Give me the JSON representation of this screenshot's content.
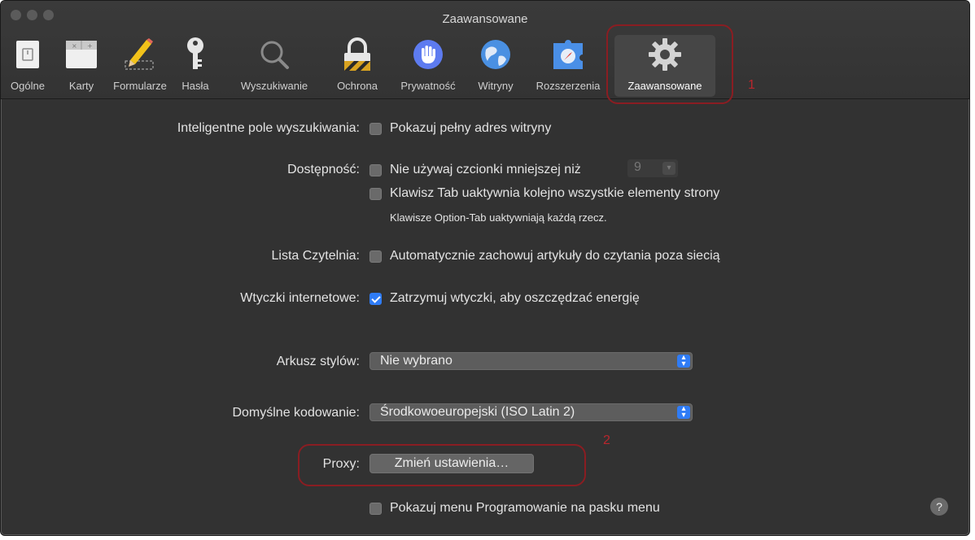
{
  "window": {
    "title": "Zaawansowane"
  },
  "toolbar": {
    "tabs": [
      {
        "label": "Ogólne",
        "icon": "switch-icon"
      },
      {
        "label": "Karty",
        "icon": "tabs-icon"
      },
      {
        "label": "Formularze",
        "icon": "pencil-icon"
      },
      {
        "label": "Hasła",
        "icon": "key-icon"
      },
      {
        "label": "Wyszukiwanie",
        "icon": "magnifier-icon"
      },
      {
        "label": "Ochrona",
        "icon": "lock-icon"
      },
      {
        "label": "Prywatność",
        "icon": "hand-icon"
      },
      {
        "label": "Witryny",
        "icon": "globe-icon"
      },
      {
        "label": "Rozszerzenia",
        "icon": "puzzle-icon"
      },
      {
        "label": "Zaawansowane",
        "icon": "gear-icon"
      }
    ],
    "selected": "Zaawansowane"
  },
  "annotations": {
    "n1": "1",
    "n2": "2"
  },
  "settings": {
    "smart_search": {
      "label": "Inteligentne pole wyszukiwania:",
      "option": "Pokazuj pełny adres witryny",
      "checked": false
    },
    "accessibility": {
      "label": "Dostępność:",
      "min_font_option": "Nie używaj czcionki mniejszej niż",
      "min_font_value": "9",
      "min_font_checked": false,
      "tab_option": "Klawisz Tab uaktywnia kolejno wszystkie elementy strony",
      "tab_checked": false,
      "tab_note": "Klawisze Option-Tab uaktywniają każdą rzecz."
    },
    "reading_list": {
      "label": "Lista Czytelnia:",
      "option": "Automatycznie zachowuj artykuły do czytania poza siecią",
      "checked": false
    },
    "plugins": {
      "label": "Wtyczki internetowe:",
      "option": "Zatrzymuj wtyczki, aby oszczędzać energię",
      "checked": true
    },
    "stylesheet": {
      "label": "Arkusz stylów:",
      "value": "Nie wybrano"
    },
    "encoding": {
      "label": "Domyślne kodowanie:",
      "value": "Środkowoeuropejski (ISO Latin 2)"
    },
    "proxy": {
      "label": "Proxy:",
      "button": "Zmień ustawienia…"
    },
    "develop": {
      "option": "Pokazuj menu Programowanie na pasku menu",
      "checked": false
    }
  },
  "help": {
    "glyph": "?"
  },
  "colors": {
    "accent": "#2f7cf6",
    "annotation": "#8a1d22"
  }
}
